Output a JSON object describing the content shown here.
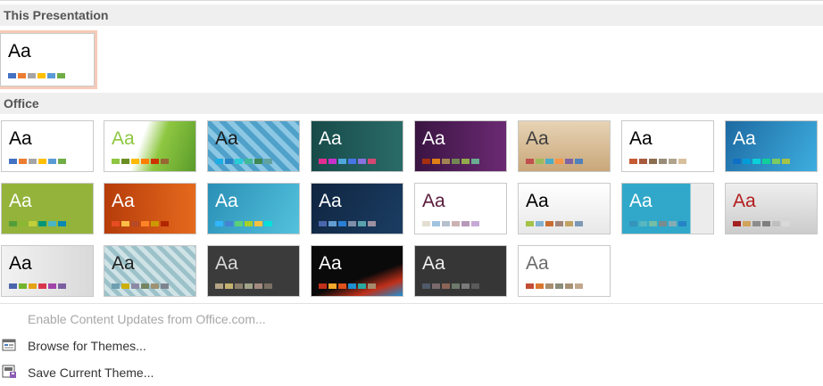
{
  "sections": {
    "this_presentation": "This Presentation",
    "office": "Office"
  },
  "current_theme": {
    "label": "Aa",
    "bg": "#ffffff",
    "text_color": "#000000",
    "swatches": [
      "#4472c4",
      "#ed7d31",
      "#a5a5a5",
      "#ffc000",
      "#5b9bd5",
      "#70ad47"
    ]
  },
  "themes": [
    {
      "label": "Aa",
      "bg": "#ffffff",
      "text_color": "#000000",
      "swatches": [
        "#4472c4",
        "#ed7d31",
        "#a5a5a5",
        "#ffc000",
        "#5b9bd5",
        "#70ad47"
      ]
    },
    {
      "label": "Aa",
      "bg": "linear-gradient(110deg,#fff 40%,#8ec741 60%,#5a9b2a 100%)",
      "text_color": "#8ec741",
      "swatches": [
        "#8ec741",
        "#6b8e23",
        "#ffb900",
        "#ff7e00",
        "#cc3300",
        "#996633"
      ]
    },
    {
      "label": "Aa",
      "bg": "repeating-linear-gradient(45deg,#4fa1c9 0 6px,#8cc7e3 6px 12px)",
      "text_color": "#1a1a1a",
      "swatches": [
        "#1cade4",
        "#2683c6",
        "#27ced7",
        "#42ba97",
        "#3e8853",
        "#62a39f"
      ]
    },
    {
      "label": "Aa",
      "bg": "linear-gradient(90deg,#174b4a,#2a6b68)",
      "text_color": "#ffffff",
      "swatches": [
        "#e32d91",
        "#c830cc",
        "#4ea6dc",
        "#4775e7",
        "#8971e1",
        "#d54773"
      ]
    },
    {
      "label": "Aa",
      "bg": "linear-gradient(90deg,#3a1442,#6b2a73)",
      "text_color": "#ffffff",
      "swatches": [
        "#a53010",
        "#de7e18",
        "#9f8351",
        "#728653",
        "#92aa4c",
        "#6aac91"
      ]
    },
    {
      "label": "Aa",
      "bg": "linear-gradient(180deg,#e7d3b5,#c9a779)",
      "text_color": "#3d3d3d",
      "swatches": [
        "#c0504d",
        "#9bbb59",
        "#4bacc6",
        "#f79646",
        "#8064a2",
        "#4f81bd"
      ]
    },
    {
      "label": "Aa",
      "bg": "#ffffff",
      "text_color": "#000000",
      "swatches": [
        "#c65b36",
        "#a85a3f",
        "#8b6d4f",
        "#998c79",
        "#b0a48e",
        "#d9c09d"
      ]
    },
    {
      "label": "Aa",
      "bg": "linear-gradient(120deg,#1d6aa2,#3eaedf)",
      "text_color": "#ffffff",
      "swatches": [
        "#0f6fc6",
        "#009dd9",
        "#0bd0d9",
        "#10cf9b",
        "#7cca62",
        "#a5c249"
      ]
    },
    {
      "label": "Aa",
      "bg": "#94b33b",
      "text_color": "#ffffff",
      "swatches": [
        "#549e39",
        "#8ab833",
        "#c0cf3a",
        "#029676",
        "#4ab5c4",
        "#0989b1"
      ]
    },
    {
      "label": "Aa",
      "bg": "linear-gradient(90deg,#b63c0a,#e56a1d)",
      "text_color": "#ffffff",
      "swatches": [
        "#e84c22",
        "#ffbd47",
        "#b64926",
        "#ff8427",
        "#cc9900",
        "#b22600"
      ]
    },
    {
      "label": "Aa",
      "bg": "linear-gradient(120deg,#2a8fb6,#53c2dd)",
      "text_color": "#ffffff",
      "swatches": [
        "#31b6fd",
        "#4584d3",
        "#5bd078",
        "#a5d028",
        "#f5c040",
        "#05e0db"
      ]
    },
    {
      "label": "Aa",
      "bg": "linear-gradient(120deg,#0f2540,#1b3d63)",
      "text_color": "#ffffff",
      "swatches": [
        "#4a66ac",
        "#629dd1",
        "#297fd5",
        "#7f8fa9",
        "#5aa2ae",
        "#9d90a0"
      ]
    },
    {
      "label": "Aa",
      "bg": "#ffffff",
      "text_color": "#5a1c3a",
      "swatches": [
        "#e3ded1",
        "#a1c3e0",
        "#b7c1cd",
        "#ccb3b3",
        "#b79ab9",
        "#c7aad6"
      ]
    },
    {
      "label": "Aa",
      "bg": "linear-gradient(180deg,#fff,#e8e8e8)",
      "text_color": "#000000",
      "swatches": [
        "#a5c249",
        "#81b2d2",
        "#c96e30",
        "#a1857b",
        "#c0a262",
        "#7d98b5"
      ]
    },
    {
      "label": "Aa",
      "bg": "linear-gradient(90deg,#31a8c9 75%,#ececec 75%)",
      "text_color": "#ffffff",
      "swatches": [
        "#3494ba",
        "#58b6c0",
        "#75bda7",
        "#7a8c8e",
        "#84acb6",
        "#2683c6"
      ]
    },
    {
      "label": "Aa",
      "bg": "linear-gradient(180deg,#eee,#ccc)",
      "text_color": "#b51c1c",
      "swatches": [
        "#a32020",
        "#d0a45b",
        "#8c8c8c",
        "#7f7f7f",
        "#bfbfbf",
        "#d9d9d9"
      ]
    },
    {
      "label": "Aa",
      "bg": "linear-gradient(90deg,#f2f2f2,#d9d9d9)",
      "text_color": "#000000",
      "swatches": [
        "#4a66ac",
        "#72b42c",
        "#e4a312",
        "#d8364d",
        "#a144a9",
        "#7b5fa1"
      ]
    },
    {
      "label": "Aa",
      "bg": "repeating-linear-gradient(45deg,#9cc1c9 0 5px,#cfe3e7 5px 10px)",
      "text_color": "#222222",
      "swatches": [
        "#6ea0b0",
        "#ccaf0a",
        "#8d89a4",
        "#748560",
        "#9e9273",
        "#7e848d"
      ]
    },
    {
      "label": "Aa",
      "bg": "#3b3b3b",
      "text_color": "#d8d8d8",
      "swatches": [
        "#b4a384",
        "#c5b26f",
        "#8c7f6d",
        "#a1a388",
        "#a28b7e",
        "#7c6f64"
      ]
    },
    {
      "label": "Aa",
      "bg": "linear-gradient(160deg,#0a0a0a 60%,#c0301a 80%,#1e8fd1 100%)",
      "text_color": "#ffffff",
      "swatches": [
        "#c0301a",
        "#f4a92c",
        "#e0521c",
        "#1e8fd1",
        "#29a8a0",
        "#a58b6d"
      ]
    },
    {
      "label": "Aa",
      "bg": "#363636",
      "text_color": "#eeeeee",
      "swatches": [
        "#4f5a6a",
        "#7a6a6d",
        "#8c6455",
        "#6e7a6b",
        "#7a7a7a",
        "#5a5a5a"
      ]
    },
    {
      "label": "Aa",
      "bg": "#ffffff",
      "text_color": "#6b6b6b",
      "swatches": [
        "#c24c34",
        "#d9762f",
        "#a78e6e",
        "#8b8c79",
        "#a79175",
        "#c3a88d"
      ]
    }
  ],
  "menu": {
    "enable_updates": "Enable Content Updates from Office.com...",
    "browse": "Browse for Themes...",
    "save": "Save Current Theme..."
  }
}
